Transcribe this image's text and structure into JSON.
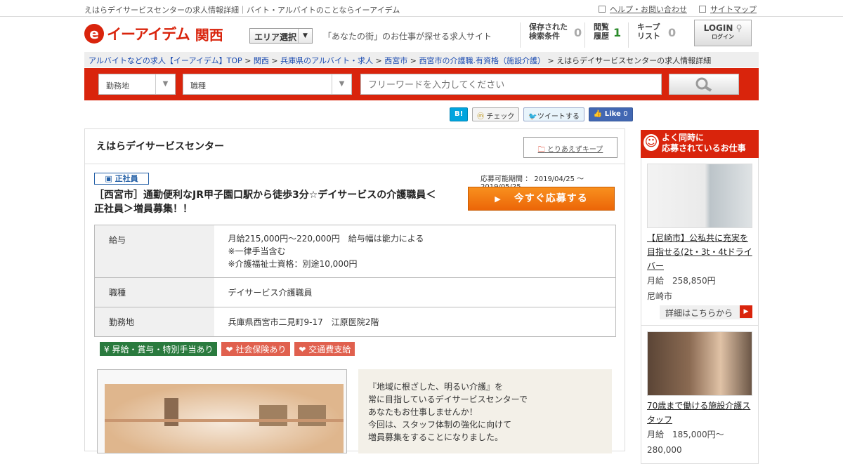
{
  "topbar": {
    "tagline": "えはらデイサービスセンターの求人情報詳細｜バイト・アルバイトのことならイーアイデム",
    "help": "ヘルプ・お問い合わせ",
    "sitemap": "サイトマップ"
  },
  "header": {
    "logo_text": "イーアイデム",
    "region": "関西",
    "area_select": "エリア選択",
    "slogan": "「あなたの街」のお仕事が探せる求人サイト",
    "saved_label1": "保存された",
    "saved_label2": "検索条件",
    "saved_count": "0",
    "history_label1": "閲覧",
    "history_label2": "履歴",
    "history_count": "1",
    "keep_label1": "キープ",
    "keep_label2": "リスト",
    "keep_count": "0",
    "login": "LOGIN",
    "login_sub": "ログイン"
  },
  "breadcrumb": [
    "アルバイトなどの求人【イーアイデム】TOP",
    "関西",
    "兵庫県のアルバイト・求人",
    "西宮市",
    "西宮市の介護職.有資格（施設介護）",
    "えはらデイサービスセンターの求人情報詳細"
  ],
  "search": {
    "location": "勤務地",
    "job_type": "職種",
    "placeholder": "フリーワードを入力してください"
  },
  "social": {
    "hatena": "B!",
    "mixi": "チェック",
    "tweet": "ツイートする",
    "like": "Like",
    "like_count": "0"
  },
  "job": {
    "company": "えはらデイサービスセンター",
    "keep": "とりあえずキープ",
    "employment": "正社員",
    "period": "応募可能期間 ： 2019/04/25 ～ 2019/05/25",
    "title": "［西宮市］通勤便利なJR甲子園口駅から徒歩3分☆デイサービスの介護職員＜正社員＞増員募集！！",
    "apply": "今すぐ応募する",
    "info": [
      {
        "label": "給与",
        "value": "月給215,000円〜220,000円　給与幅は能力による\n※一律手当含む\n※介護福祉士資格：別途10,000円"
      },
      {
        "label": "職種",
        "value": "デイサービス介護職員"
      },
      {
        "label": "勤務地",
        "value": "兵庫県西宮市二見町9-17　江原医院2階"
      }
    ],
    "tags": [
      "¥ 昇給・賞与・特別手当あり",
      "❤ 社会保険あり",
      "❤ 交通費支給"
    ],
    "description": [
      "『地域に根ざした、明るい介護』を",
      "常に目指しているデイサービスセンターで",
      "あなたもお仕事しませんか！",
      "今回は、スタッフ体制の強化に向けて",
      "増員募集をすることになりました。"
    ]
  },
  "sidebar": {
    "head1": "よく同時に",
    "head2": "応募されているお仕事",
    "cards": [
      {
        "title": "【尼崎市】公私共に充実を目指せる(2t・3t・4tドライバー",
        "salary": "月給　258,850円",
        "location": "尼崎市",
        "more": "詳細はこちらから"
      },
      {
        "title": "70歳まで働ける施設介護スタッフ",
        "salary": "月給　185,000円〜280,000"
      }
    ]
  },
  "colors": {
    "brand": "#d9240c",
    "apply": "#ec6608",
    "tag_green": "#2a7a3e",
    "tag_red": "#e0604e"
  }
}
